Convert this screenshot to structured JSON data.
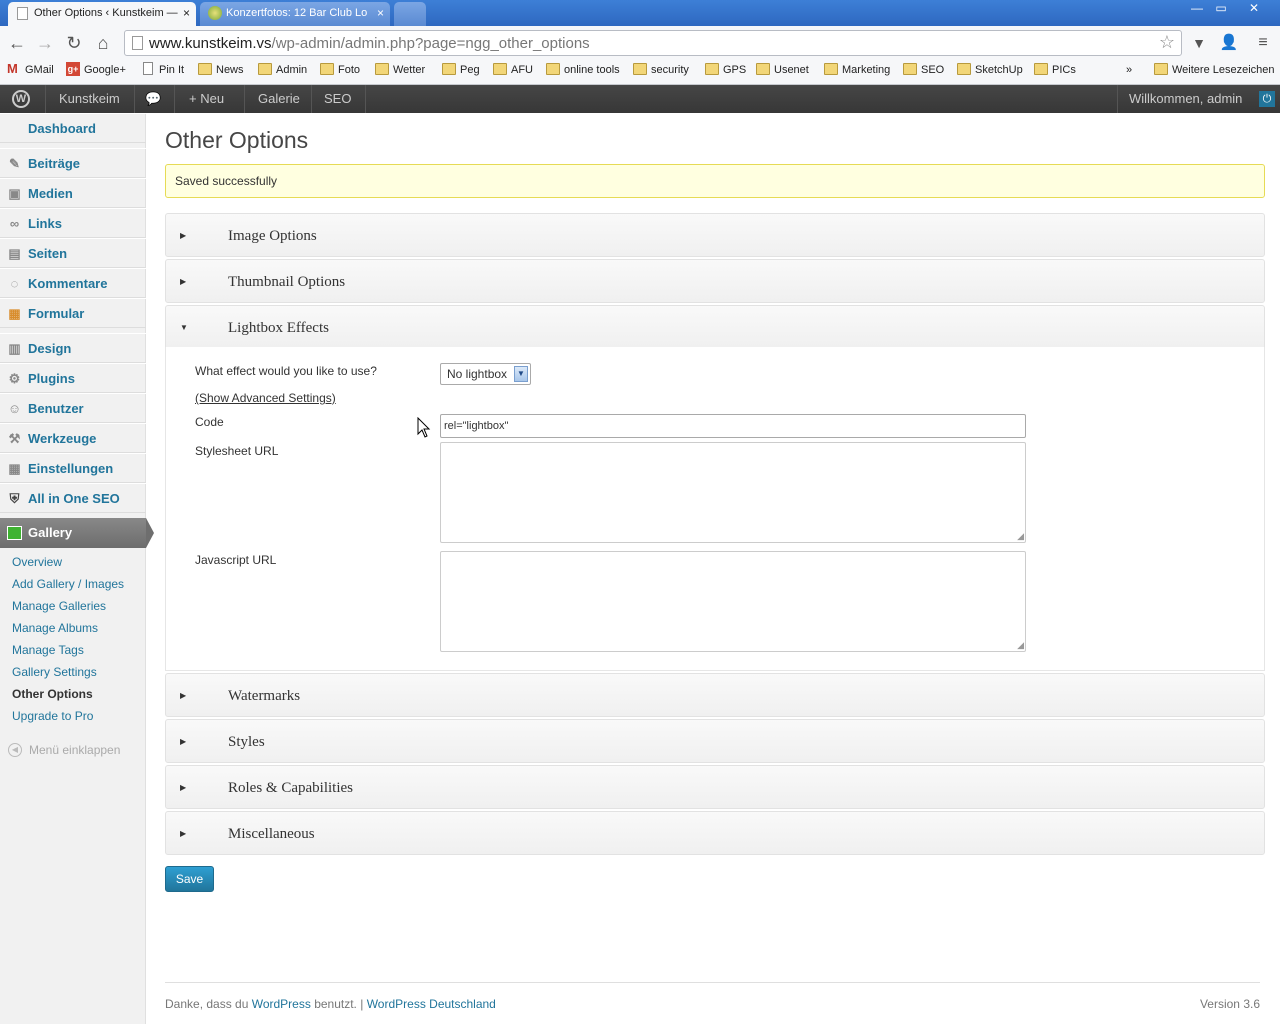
{
  "browser": {
    "tabs": [
      {
        "label": "Other Options ‹ Kunstkeim —",
        "close": "×"
      },
      {
        "label": "Konzertfotos: 12 Bar Club Lo",
        "close": "×"
      }
    ],
    "window": {
      "minimize": "—",
      "maximize": "▭",
      "close": "✕"
    },
    "url_prefix": "www.kunstkeim.vs",
    "url_path": "/wp-admin/admin.php?page=ngg_other_options",
    "bookmarks": [
      "GMail",
      "Google+",
      "Pin It",
      "News",
      "Admin",
      "Foto",
      "Wetter",
      "Peg",
      "AFU",
      "online tools",
      "security",
      "GPS",
      "Usenet",
      "Marketing",
      "SEO",
      "SketchUp",
      "PICs"
    ],
    "bookmarks_more": "»",
    "bookmarks_other": "Weitere Lesezeichen"
  },
  "adminbar": {
    "site": "Kunstkeim",
    "new": "Neu",
    "gallery": "Galerie",
    "seo": "SEO",
    "welcome": "Willkommen, admin"
  },
  "sidebar": {
    "items": [
      "Dashboard",
      "Beiträge",
      "Medien",
      "Links",
      "Seiten",
      "Kommentare",
      "Formular",
      "Design",
      "Plugins",
      "Benutzer",
      "Werkzeuge",
      "Einstellungen",
      "All in One SEO"
    ],
    "gallery": "Gallery",
    "submenu": [
      "Overview",
      "Add Gallery / Images",
      "Manage Galleries",
      "Manage Albums",
      "Manage Tags",
      "Gallery Settings",
      "Other Options",
      "Upgrade to Pro"
    ],
    "collapse": "Menü einklappen"
  },
  "page": {
    "title": "Other Options",
    "notice": "Saved successfully",
    "sections": [
      "Image Options",
      "Thumbnail Options",
      "Lightbox Effects",
      "Watermarks",
      "Styles",
      "Roles & Capabilities",
      "Miscellaneous"
    ],
    "lightbox": {
      "effect_label": "What effect would you like to use?",
      "effect_value": "No lightbox",
      "advanced_link": "(Show Advanced Settings)",
      "code_label": "Code",
      "code_value": "rel=\"lightbox\"",
      "stylesheet_label": "Stylesheet URL",
      "javascript_label": "Javascript URL"
    },
    "save": "Save"
  },
  "footer": {
    "text_pre": "Danke, dass du ",
    "wp_link": "WordPress",
    "text_mid": " benutzt. | ",
    "wpde_link": "WordPress Deutschland",
    "version": "Version 3.6"
  }
}
